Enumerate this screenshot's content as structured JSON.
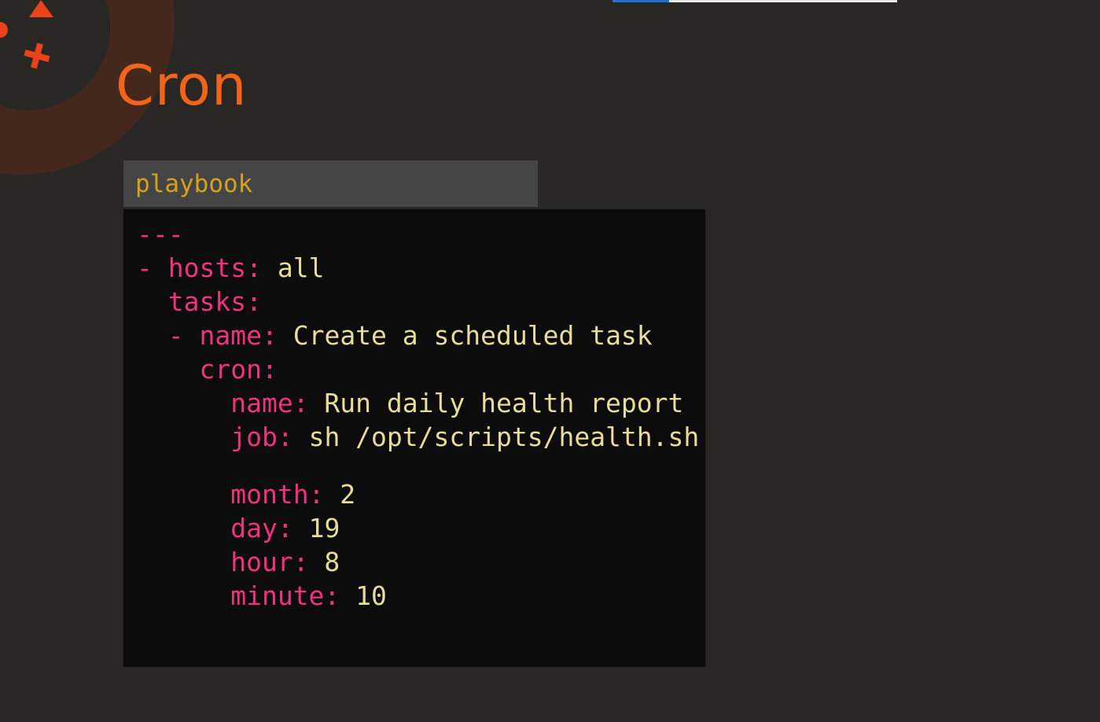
{
  "slide": {
    "title": "Cron"
  },
  "progress": {
    "fraction": 0.2,
    "colors": {
      "fill": "#1e6fd0",
      "track": "#e8e8e8"
    }
  },
  "decoration": {
    "icons": [
      "circle-icon",
      "triangle-icon",
      "plus-icon"
    ],
    "color": "#e8431a"
  },
  "code_block": {
    "label": "playbook",
    "doc_start": "---",
    "line_hosts": {
      "dash": "- ",
      "key": "hosts:",
      "value": " all"
    },
    "line_tasks": {
      "key": "tasks:"
    },
    "line_task_name": {
      "dash": "- ",
      "key": "name:",
      "value": " Create a scheduled task"
    },
    "line_cron": {
      "key": "cron:"
    },
    "line_cron_name": {
      "key": "name:",
      "value": " Run daily health report"
    },
    "line_job": {
      "key": "job:",
      "value": " sh /opt/scripts/health.sh"
    },
    "line_month": {
      "key": "month:",
      "value": " 2"
    },
    "line_day": {
      "key": "day:",
      "value": " 19"
    },
    "line_hour": {
      "key": "hour:",
      "value": " 8"
    },
    "line_minute": {
      "key": "minute:",
      "value": " 10"
    }
  },
  "colors": {
    "background": "#282724",
    "title": "#f26419",
    "label_text": "#d6a21e",
    "label_background": "#454545",
    "code_background": "#0c0c0c",
    "yaml_key": "#f0337c",
    "yaml_value": "#e8dc9a"
  }
}
